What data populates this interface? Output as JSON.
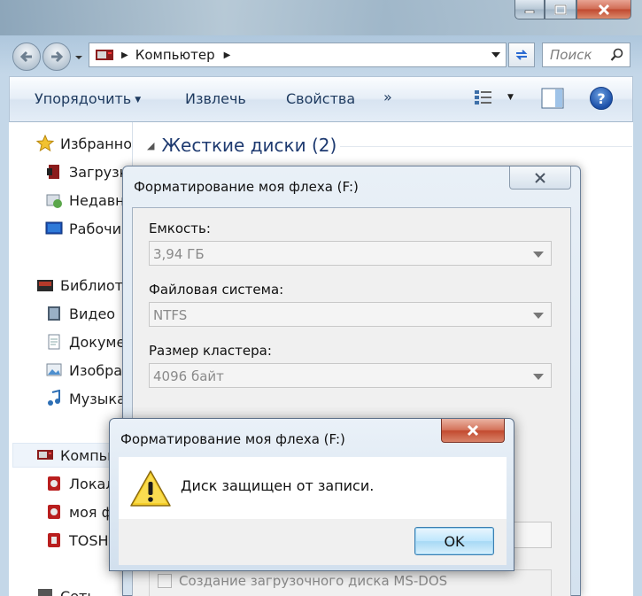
{
  "explorer": {
    "address": {
      "crumbs": [
        "Компьютер"
      ]
    },
    "search": {
      "placeholder": "Поиск"
    },
    "toolbar": {
      "organize": "Упорядочить",
      "eject": "Извлечь",
      "properties": "Свойства",
      "more": "»"
    },
    "nav": {
      "items": [
        {
          "label": "Избранное",
          "icon": "star-icon"
        },
        {
          "label": "Загрузки",
          "icon": "downloads-icon"
        },
        {
          "label": "Недавние места",
          "icon": "recent-places-icon"
        },
        {
          "label": "Рабочий стол",
          "icon": "desktop-icon"
        },
        {
          "label": "Библиотеки",
          "icon": "libraries-icon"
        },
        {
          "label": "Видео",
          "icon": "video-icon"
        },
        {
          "label": "Документы",
          "icon": "documents-icon"
        },
        {
          "label": "Изображения",
          "icon": "pictures-icon"
        },
        {
          "label": "Музыка",
          "icon": "music-icon"
        },
        {
          "label": "Компьютер",
          "icon": "computer-icon"
        },
        {
          "label": "Локальный диск",
          "icon": "local-disk-icon"
        },
        {
          "label": "моя флеха",
          "icon": "usb-drive-icon"
        },
        {
          "label": "TOSHIBA",
          "icon": "usb-drive-icon"
        },
        {
          "label": "Сеть",
          "icon": "network-icon"
        }
      ]
    },
    "group_header": "Жесткие диски (2)"
  },
  "format_dialog": {
    "title": "Форматирование моя флеха (F:)",
    "capacity_label": "Емкость:",
    "capacity_value": "3,94 ГБ",
    "fs_label": "Файловая система:",
    "fs_value": "NTFS",
    "cluster_label": "Размер кластера:",
    "cluster_value": "4096 байт",
    "msdos_label": "Создание загрузочного диска MS-DOS"
  },
  "message_box": {
    "title": "Форматирование моя флеха (F:)",
    "text": "Диск защищен от записи.",
    "ok": "OK"
  },
  "colors": {
    "accent": "#1e3a70",
    "close_red": "#c24a2f",
    "ok_border": "#3c7fb1"
  }
}
